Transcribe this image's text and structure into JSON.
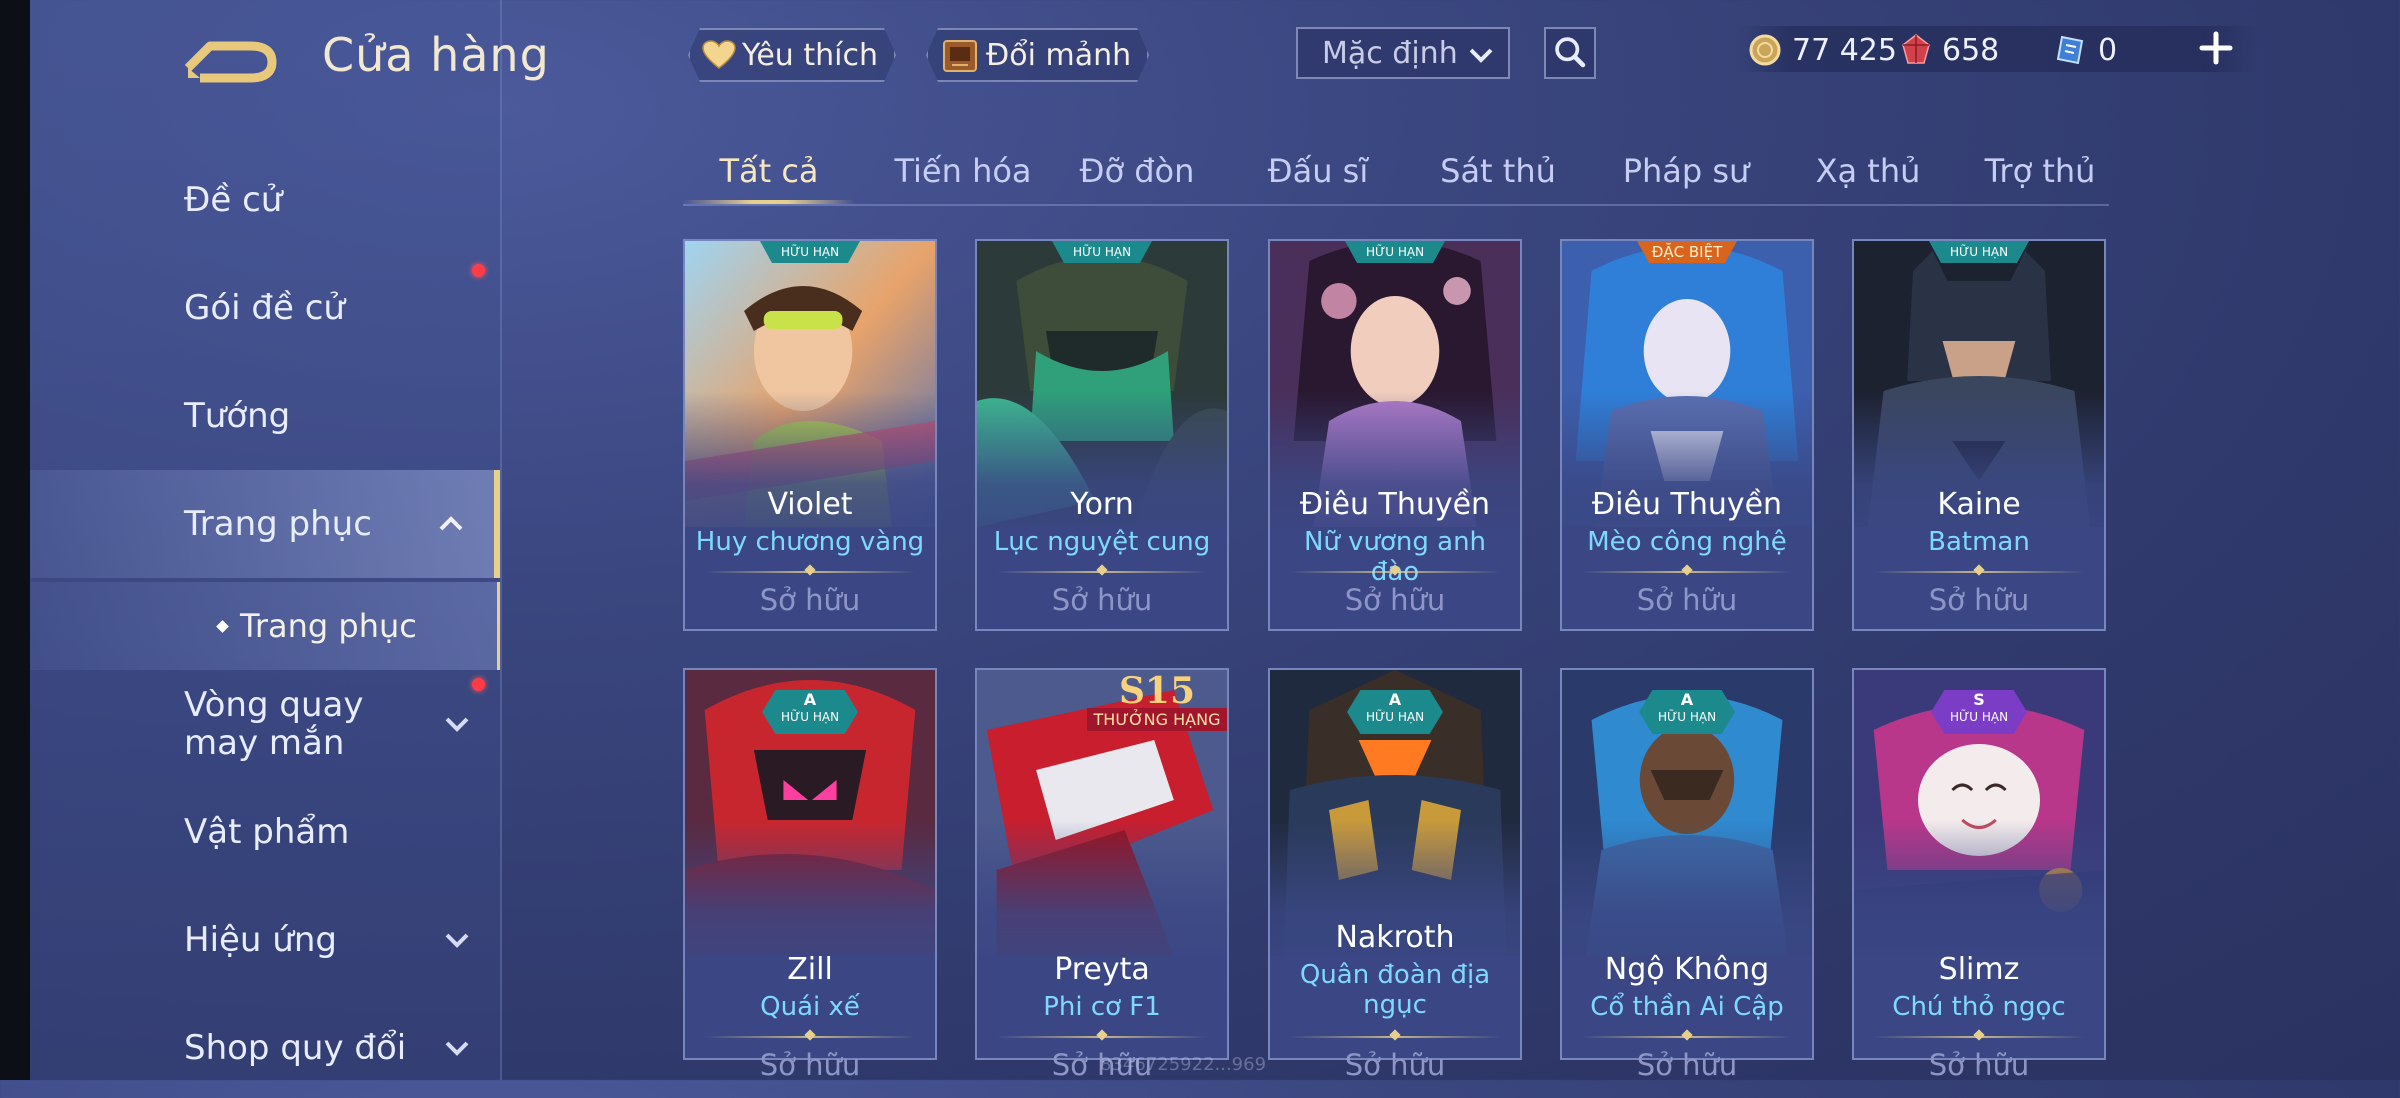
{
  "header": {
    "title": "Cửa hàng",
    "favorites_label": "Yêu thích",
    "exchange_label": "Đổi mảnh",
    "sort_value": "Mặc định"
  },
  "currency": {
    "gold": "77 425",
    "ruby": "658",
    "tickets": "0"
  },
  "sidebar": {
    "items": [
      {
        "label": "Đề cử"
      },
      {
        "label": "Gói đề cử"
      },
      {
        "label": "Tướng"
      },
      {
        "label": "Trang phục"
      },
      {
        "label": "Vòng quay may mắn"
      },
      {
        "label": "Vật phẩm"
      },
      {
        "label": "Hiệu ứng"
      },
      {
        "label": "Shop quy đổi"
      }
    ],
    "sub_label": "Trang phục"
  },
  "tabs": [
    "Tất cả",
    "Tiến hóa",
    "Đỡ đòn",
    "Đấu sĩ",
    "Sát thủ",
    "Pháp sư",
    "Xạ thủ",
    "Trợ thủ"
  ],
  "cards": [
    {
      "hero": "Violet",
      "skin": "Huy chương vàng",
      "status": "Sở hữu",
      "badge": "HỮU HẠN"
    },
    {
      "hero": "Yorn",
      "skin": "Lục nguyệt cung",
      "status": "Sở hữu",
      "badge": "HỮU HẠN"
    },
    {
      "hero": "Điêu Thuyền",
      "skin": "Nữ vương anh đào",
      "status": "Sở hữu",
      "badge": "HỮU HẠN"
    },
    {
      "hero": "Điêu Thuyền",
      "skin": "Mèo công nghệ",
      "status": "Sở hữu",
      "badge": "ĐẶC BIỆT"
    },
    {
      "hero": "Kaine",
      "skin": "Batman",
      "status": "Sở hữu",
      "badge": "HỮU HẠN"
    },
    {
      "hero": "Zill",
      "skin": "Quái xế",
      "status": "Sở hữu",
      "badge_grade": "A",
      "badge": "HỮU HẠN"
    },
    {
      "hero": "Preyta",
      "skin": "Phi cơ F1",
      "status": "Sở hữu",
      "season": "S15",
      "season_rank": "THƯỞNG HẠNG"
    },
    {
      "hero": "Nakroth",
      "skin": "Quân đoàn địa ngục",
      "status": "Sở hữu",
      "badge_grade": "A",
      "badge": "HỮU HẠN"
    },
    {
      "hero": "Ngộ Không",
      "skin": "Cổ thần Ai Cập",
      "status": "Sở hữu",
      "badge_grade": "A",
      "badge": "HỮU HẠN"
    },
    {
      "hero": "Slimz",
      "skin": "Chú thỏ ngọc",
      "status": "Sở hữu",
      "badge_grade": "S",
      "badge": "HỮU HẠN"
    }
  ],
  "watermark": "8346725922...969",
  "colors": {
    "accent_gold": "#e7cf8e",
    "skin_name": "#7fd8ff",
    "notification": "#ff3b45",
    "badge_teal": "#1c8a8d",
    "badge_special": "#d9641d",
    "badge_s": "#7b3cc6"
  },
  "icons": {
    "back": "back-arrow-icon",
    "heart": "heart-icon",
    "exchange": "shard-box-icon",
    "search": "search-icon",
    "gold": "gold-coin-icon",
    "ruby": "ruby-icon",
    "ticket": "voucher-icon",
    "plus": "plus-icon"
  }
}
